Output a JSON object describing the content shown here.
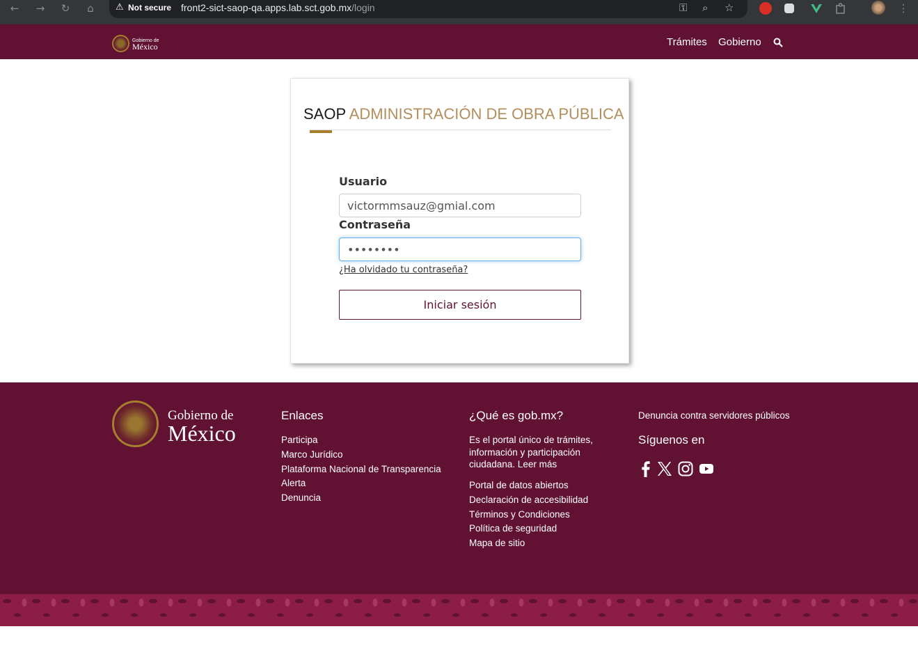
{
  "browser": {
    "security_label": "Not secure",
    "url_host": "front2-sict-saop-qa.apps.lab.sct.gob.mx",
    "url_path": "/login"
  },
  "header": {
    "logo_line1": "Gobierno de",
    "logo_line2": "México",
    "nav": [
      "Trámites",
      "Gobierno"
    ]
  },
  "login": {
    "title_prefix": "SAOP",
    "title_main": "ADMINISTRACIÓN DE OBRA PÚBLICA",
    "user_label": "Usuario",
    "user_value": "victormmsauz@gmial.com",
    "password_label": "Contraseña",
    "password_value": "••••••••",
    "forgot_link": "¿Ha olvidado tu contraseña?",
    "submit_label": "Iniciar sesión"
  },
  "footer": {
    "logo_line1": "Gobierno de",
    "logo_line2": "México",
    "enlaces_title": "Enlaces",
    "enlaces": [
      "Participa",
      "Marco Jurídico",
      "Plataforma Nacional de Transparencia",
      "Alerta",
      "Denuncia"
    ],
    "que_es_title": "¿Qué es gob.mx?",
    "que_es_desc": "Es el portal único de trámites, información y participación ciudadana. Leer más",
    "que_es_links": [
      "Portal de datos abiertos",
      "Declaración de accesibilidad",
      "Términos y Condiciones",
      "Política de seguridad",
      "Mapa de sitio"
    ],
    "denuncia_link": "Denuncia contra servidores públicos",
    "siguenos_title": "Síguenos en",
    "social_icons": [
      "facebook-icon",
      "x-icon",
      "instagram-icon",
      "youtube-icon"
    ]
  },
  "colors": {
    "brand_primary": "#611232",
    "brand_gold": "#a57f2c",
    "title_gold": "#b38e5d",
    "focus_blue": "#66afe9"
  }
}
